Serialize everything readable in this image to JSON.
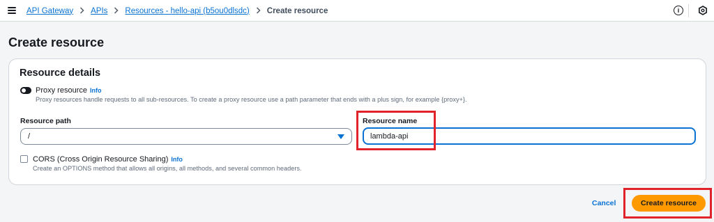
{
  "breadcrumb": {
    "items": [
      "API Gateway",
      "APIs",
      "Resources - hello-api (b5ou0dlsdc)"
    ],
    "current": "Create resource"
  },
  "icons": {
    "menu": "hamburger-menu-icon",
    "info": "info-circle-icon",
    "settings": "hexagon-settings-icon",
    "toggle": "toggle-off",
    "select_caret": "caret-down-icon"
  },
  "page": {
    "title": "Create resource"
  },
  "resource_details": {
    "heading": "Resource details",
    "proxy": {
      "label": "Proxy resource",
      "info": "Info",
      "enabled": false,
      "description": "Proxy resources handle requests to all sub-resources. To create a proxy resource use a path parameter that ends with a plus sign, for example {proxy+}."
    },
    "resource_path": {
      "label": "Resource path",
      "value": "/"
    },
    "resource_name": {
      "label": "Resource name",
      "value": "lambda-api"
    },
    "cors": {
      "label": "CORS (Cross Origin Resource Sharing)",
      "info": "Info",
      "checked": false,
      "description": "Create an OPTIONS method that allows all origins, all methods, and several common headers."
    }
  },
  "actions": {
    "cancel": "Cancel",
    "submit": "Create resource"
  },
  "colors": {
    "link": "#0972d3",
    "primary_button": "#ff9900",
    "highlight": "#e1222a"
  }
}
